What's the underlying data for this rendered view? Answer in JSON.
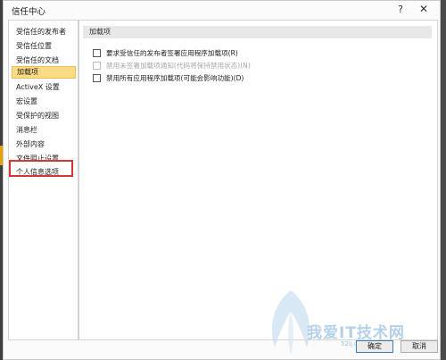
{
  "window": {
    "title": "信任中心",
    "help_glyph": "?",
    "close_glyph": "✕"
  },
  "sidebar": {
    "items": [
      {
        "label": "受信任的发布者"
      },
      {
        "label": "受信任位置"
      },
      {
        "label": "受信任的文档"
      },
      {
        "label": "加载项",
        "selected": true
      },
      {
        "label": "ActiveX 设置"
      },
      {
        "label": "宏设置"
      },
      {
        "label": "受保护的视图"
      },
      {
        "label": "消息栏"
      },
      {
        "label": "外部内容"
      },
      {
        "label": "文件阻止设置"
      },
      {
        "label": "个人信息选项",
        "highlighted": true
      }
    ]
  },
  "main": {
    "section_title": "加载项",
    "options": [
      {
        "label": "要求受信任的发布者签署应用程序加载项(R)",
        "checked": false,
        "enabled": true
      },
      {
        "label": "禁用未签署加载项通知(代码将保持禁用状态)(N)",
        "checked": false,
        "enabled": false
      },
      {
        "label": "禁用所有应用程序加载项(可能会影响功能)(D)",
        "checked": false,
        "enabled": true
      }
    ]
  },
  "buttons": {
    "ok": "确定",
    "cancel": "取消"
  },
  "watermark": {
    "text": "我爱IT技术网",
    "url": "52ij.com"
  },
  "colors": {
    "selected_bg": "#fcdb86",
    "highlight_border": "#d93535",
    "section_bg": "#e8e8e8"
  }
}
